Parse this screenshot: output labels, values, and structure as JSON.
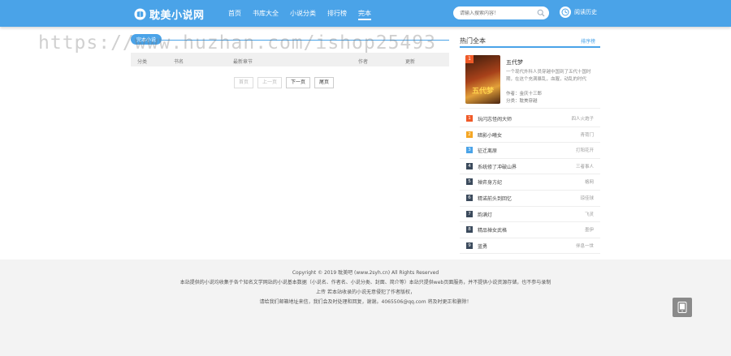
{
  "header": {
    "logo_text": "耽美小说网",
    "nav": [
      "首页",
      "书库大全",
      "小说分类",
      "排行榜",
      "完本"
    ],
    "active_nav": 4,
    "search_placeholder": "请输入搜索内容！",
    "history_label": "阅读历史"
  },
  "watermark": "https://www.huzhan.com/ishop25493",
  "main": {
    "tab_label": "完本小说",
    "columns": [
      "分类",
      "书名",
      "最新章节",
      "作者",
      "更新"
    ],
    "pager": [
      "首页",
      "上一页",
      "下一页",
      "尾页"
    ]
  },
  "sidebar": {
    "title": "热门全本",
    "more": "排序榜",
    "featured": {
      "rank": "1",
      "cover_text": "五代梦",
      "name": "五代梦",
      "desc": "一个现代外科人员穿越中国到了五代十国时期，在这个充满暴乱，血腥，动乱的时代",
      "author": "作者：金庆十三郎",
      "category": "分类：耽美穿越"
    },
    "items": [
      {
        "rank": "1",
        "title": "玩闪志怪闹大师",
        "author": "四人火炮子"
      },
      {
        "rank": "2",
        "title": "暗影小曦女",
        "author": "青荷门"
      },
      {
        "rank": "3",
        "title": "征迁离原",
        "author": "打阳花开"
      },
      {
        "rank": "4",
        "title": "系统修了冲破山界",
        "author": "三者事人"
      },
      {
        "rank": "5",
        "title": "禅弈身方纪",
        "author": "格网"
      },
      {
        "rank": "6",
        "title": "精诺前头到回忆",
        "author": "琼佳球"
      },
      {
        "rank": "7",
        "title": "韵满灯",
        "author": "飞灵"
      },
      {
        "rank": "8",
        "title": "精品禅女武格",
        "author": "墨伊"
      },
      {
        "rank": "9",
        "title": "蓝勇",
        "author": "伴息一世"
      }
    ]
  },
  "footer": {
    "lines": [
      "Copyright © 2019 耽美吧 (www.2syh.cn) All Rights Reserved",
      "本站提供的小说均收集于各个知名文学网站的小说基本数据（小说名、作者名、小说分类、封面、简介等）本站只提供web页面服务，并不提供小说资源存储，也不参与录制",
      "上传 若本站收录的小说无意侵犯了作者版权，",
      "请给我们邮箱地址来信，我们会及时处理和回复，谢谢。4065506@qq.com 将及时更正和删除！"
    ]
  }
}
